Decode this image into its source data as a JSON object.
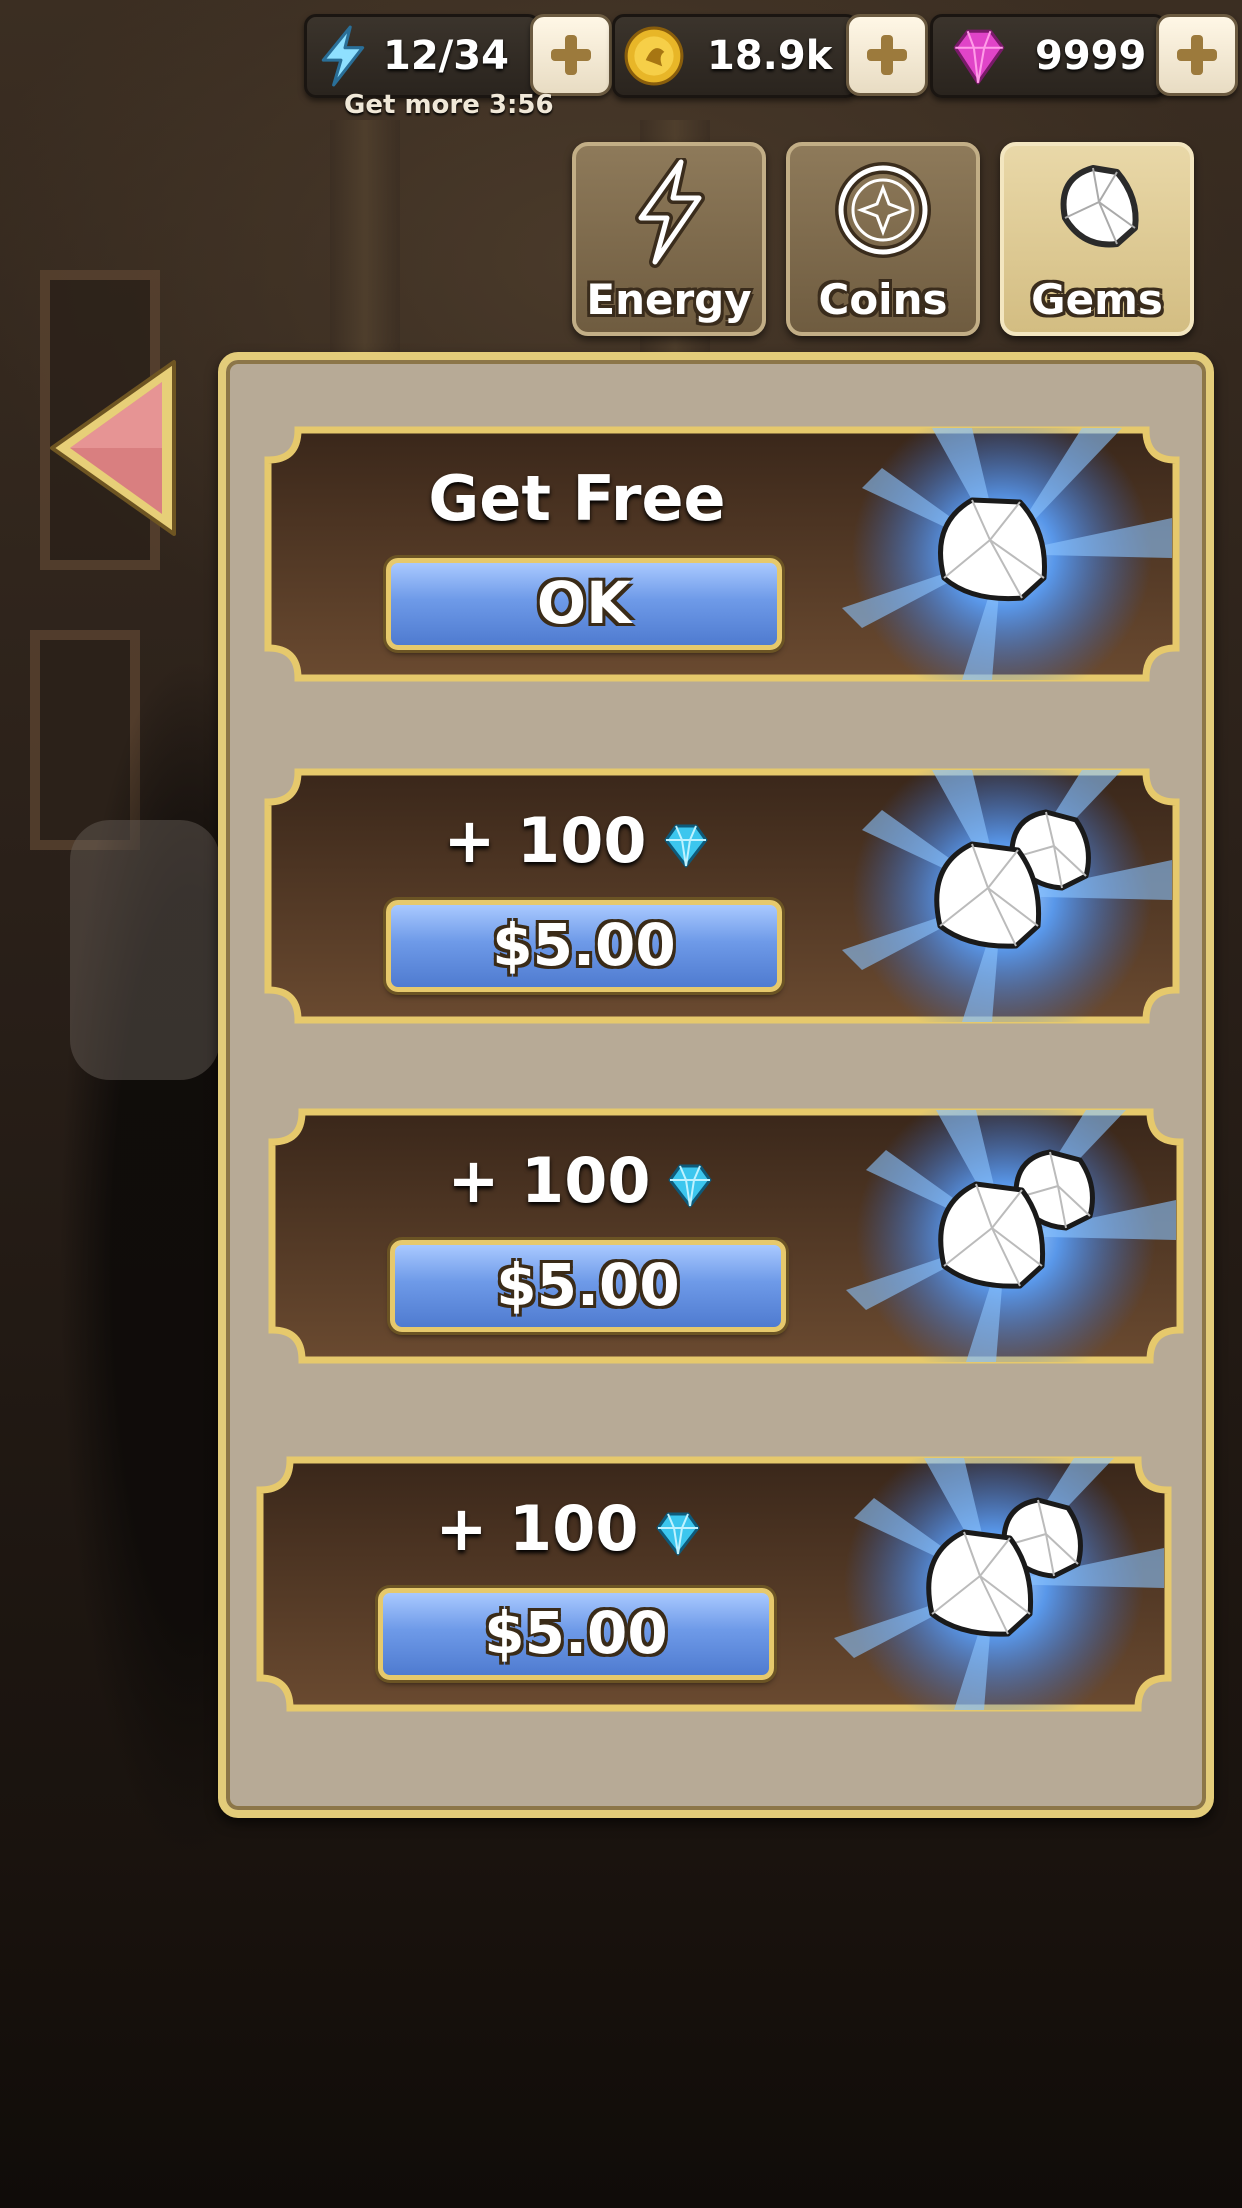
{
  "currency": {
    "energy": {
      "value": "12/34",
      "timer": "Get more 3:56"
    },
    "coins": {
      "value": "18.9k"
    },
    "gems": {
      "value": "9999"
    }
  },
  "tabs": [
    {
      "label": "Energy",
      "icon": "lightning-icon",
      "active": false
    },
    {
      "label": "Coins",
      "icon": "coin-icon",
      "active": false
    },
    {
      "label": "Gems",
      "icon": "gem-icon",
      "active": true
    }
  ],
  "offers": [
    {
      "title": "Get Free",
      "button": "OK",
      "art": "single-gem"
    },
    {
      "title": "+ 100",
      "button": "$5.00",
      "art": "double-gem"
    },
    {
      "title": "+ 100",
      "button": "$5.00",
      "art": "double-gem"
    },
    {
      "title": "+ 100",
      "button": "$5.00",
      "art": "double-gem"
    }
  ],
  "colors": {
    "panel": "#b7aa96",
    "panel_border": "#e3cc7a",
    "button_blue": "#6e9ae8",
    "back_arrow": "#d97f80"
  }
}
